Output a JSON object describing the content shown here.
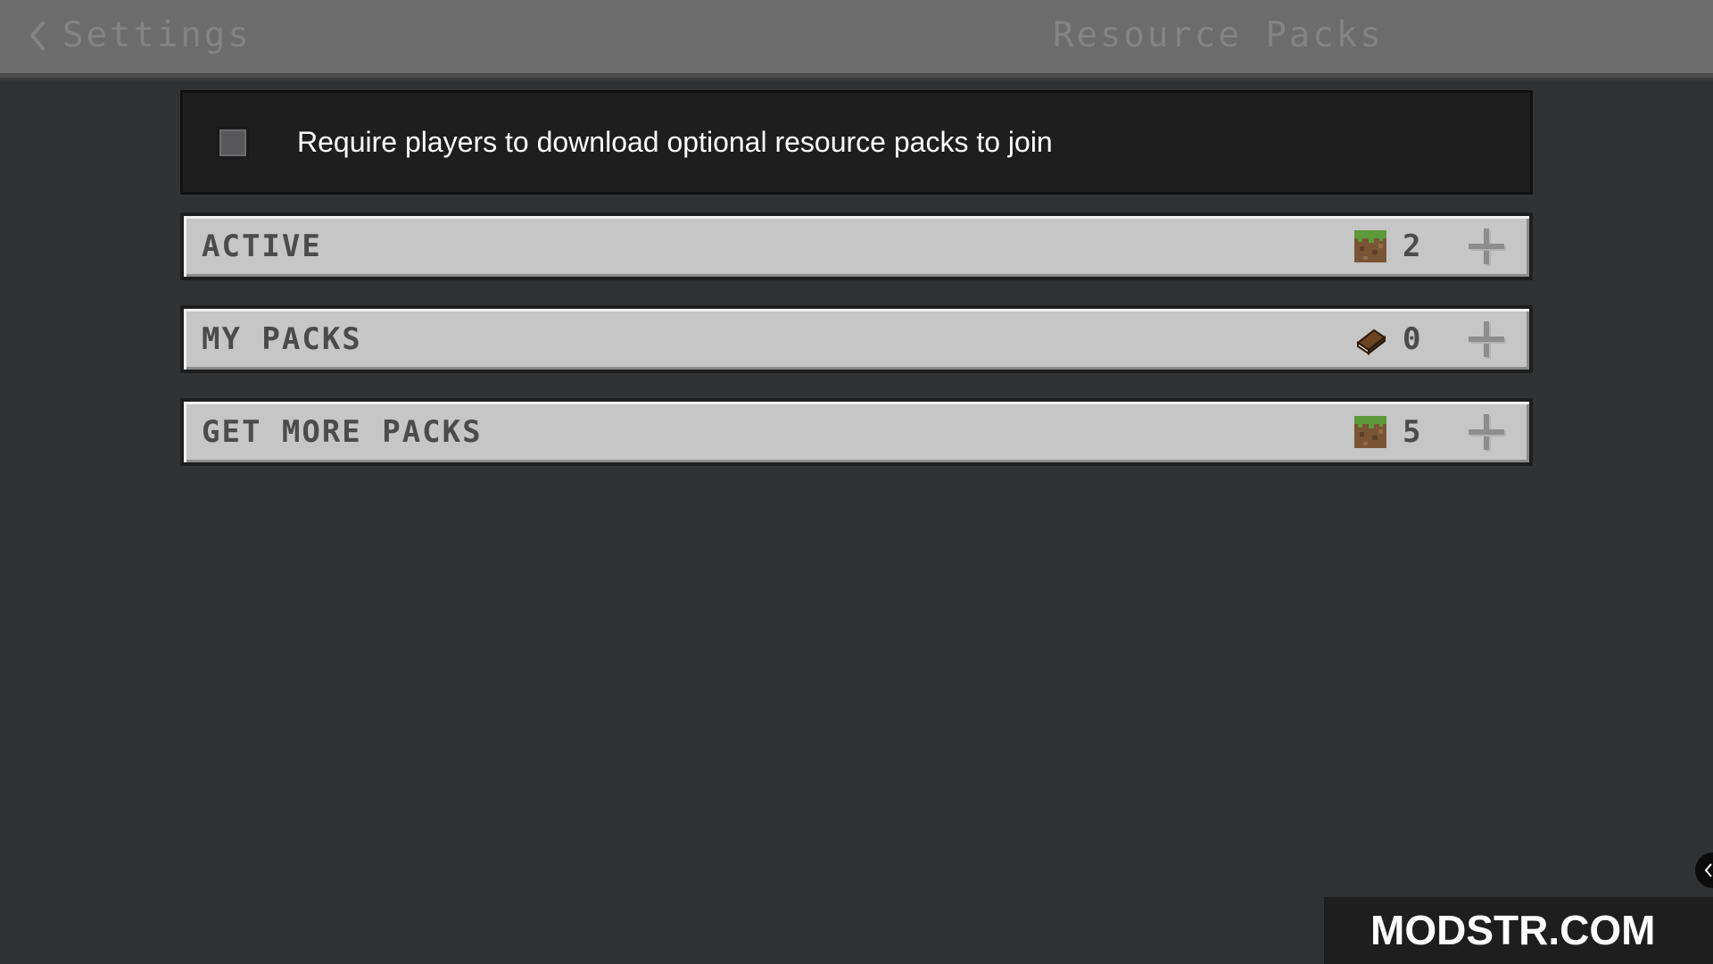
{
  "header": {
    "back_label": "Settings",
    "title": "Resource Packs"
  },
  "require_option": {
    "label": "Require players to download optional resource packs to join",
    "checked": false
  },
  "pack_sections": [
    {
      "label": "ACTIVE",
      "count": "2",
      "icon": "grass-block-icon"
    },
    {
      "label": "MY PACKS",
      "count": "0",
      "icon": "book-icon"
    },
    {
      "label": "GET MORE PACKS",
      "count": "5",
      "icon": "grass-block-icon"
    }
  ],
  "watermark": {
    "text": "MODSTR.COM"
  },
  "colors": {
    "background": "#313233",
    "header_bar": "#6b6c6b",
    "row_fill": "#c6c6c6",
    "row_text": "#4b4b4c"
  }
}
